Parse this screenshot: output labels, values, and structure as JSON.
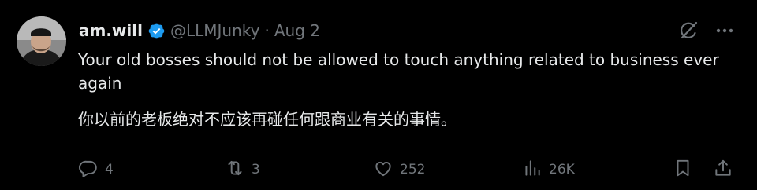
{
  "author": {
    "name": "am.will",
    "handle": "@LLMJunky",
    "separator": "·",
    "date": "Aug 2",
    "verified": true
  },
  "content": {
    "english": "Your old bosses should not be allowed to touch anything related to business ever again",
    "chinese": "你以前的老板绝对不应该再碰任何跟商业有关的事情。"
  },
  "actions": {
    "replies": "4",
    "reposts": "3",
    "likes": "252",
    "views": "26K"
  },
  "icons": {
    "verified": "verified-badge-icon",
    "grok": "grok-icon",
    "more": "more-icon",
    "reply": "reply-icon",
    "repost": "repost-icon",
    "like": "like-icon",
    "views": "views-icon",
    "bookmark": "bookmark-icon",
    "share": "share-icon"
  },
  "colors": {
    "background": "#000000",
    "text": "#e7e9ea",
    "muted": "#71767b",
    "verified": "#1d9bf0"
  }
}
